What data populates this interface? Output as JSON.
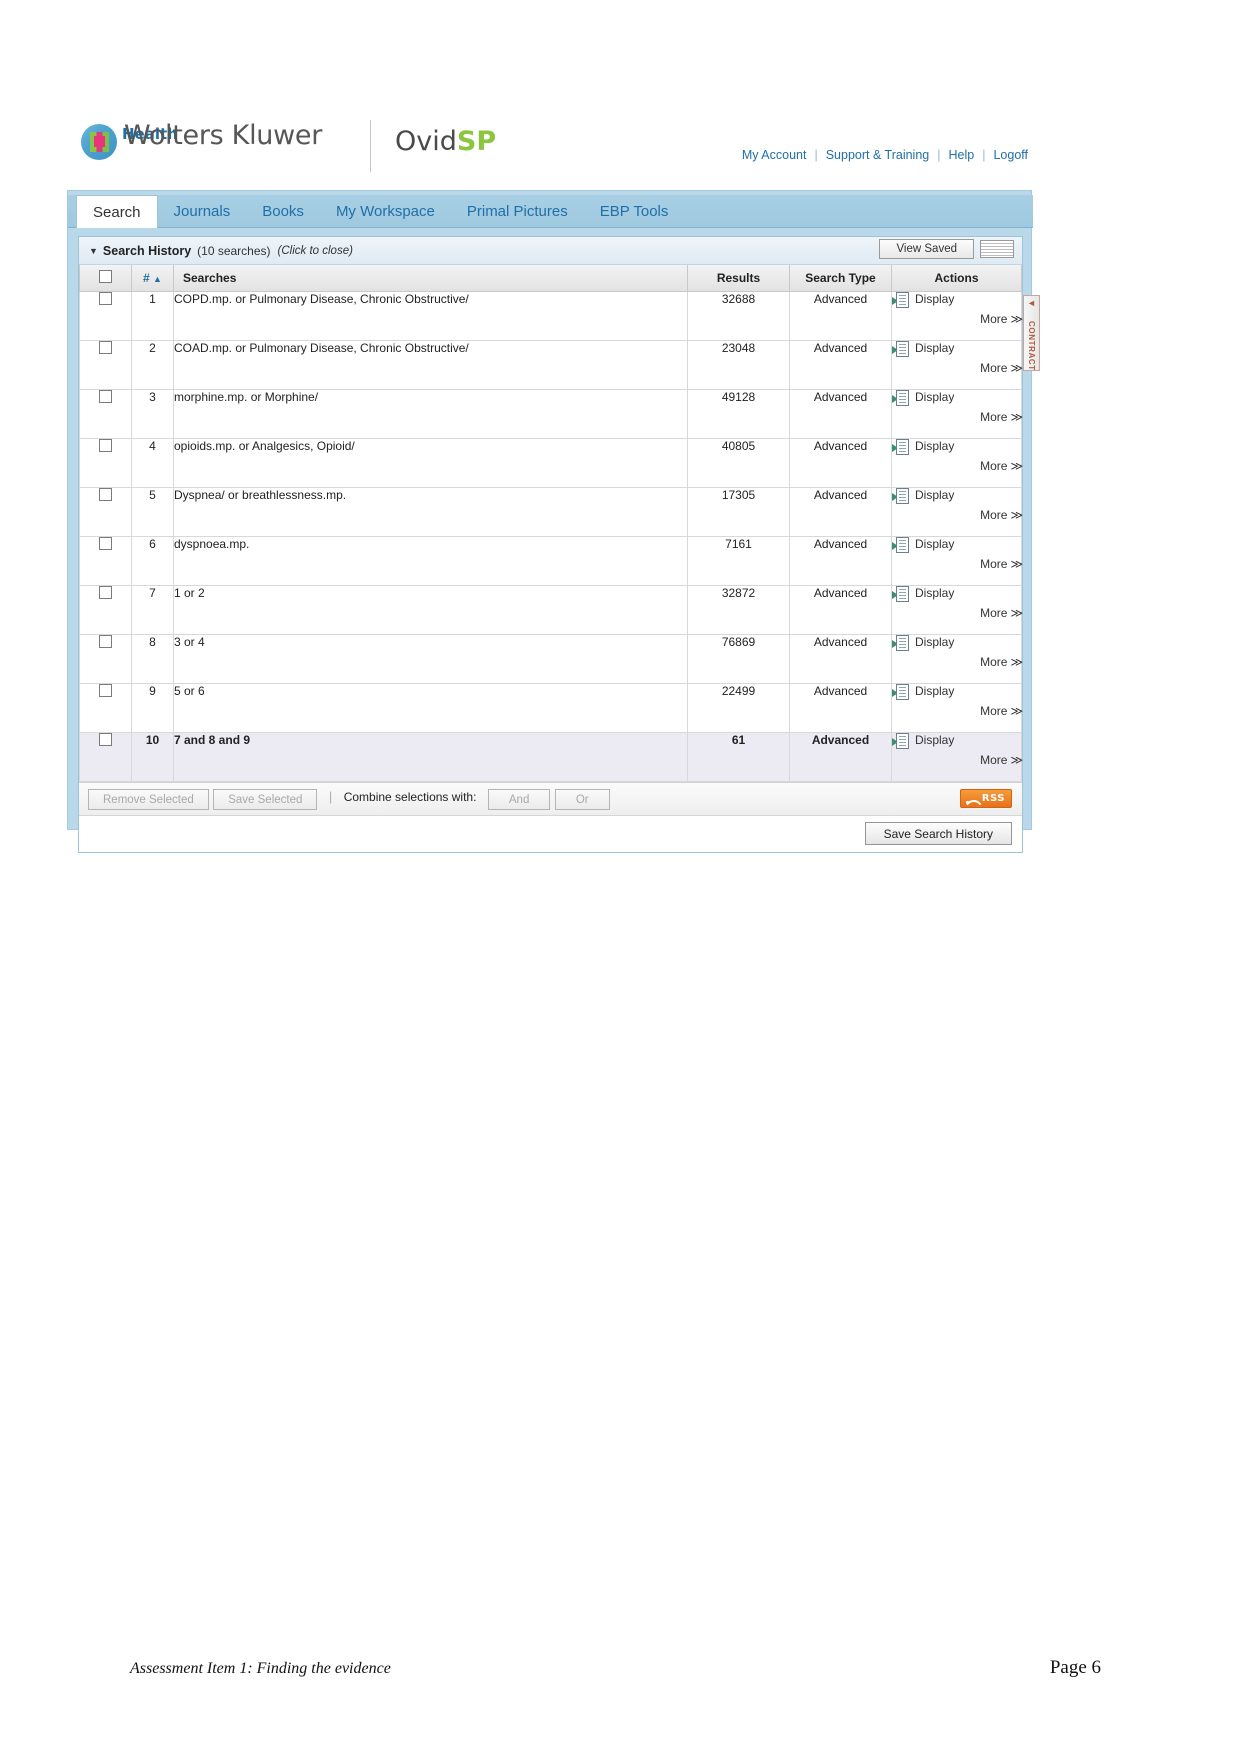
{
  "brand": {
    "company": "Wolters Kluwer",
    "division": "Health",
    "product_prefix": "Ovid",
    "product_suffix": "SP",
    "globe_icon": "wolters-kluwer-globe-icon"
  },
  "top_links": [
    {
      "label": "My Account"
    },
    {
      "label": "Support & Training"
    },
    {
      "label": "Help"
    },
    {
      "label": "Logoff"
    }
  ],
  "tabs": [
    {
      "label": "Search",
      "active": true
    },
    {
      "label": "Journals",
      "active": false
    },
    {
      "label": "Books",
      "active": false
    },
    {
      "label": "My Workspace",
      "active": false
    },
    {
      "label": "Primal Pictures",
      "active": false
    },
    {
      "label": "EBP Tools",
      "active": false
    }
  ],
  "history_panel": {
    "caret": "▼",
    "title": "Search History",
    "count": "(10 searches)",
    "click_hint": "(Click to close)",
    "view_saved_label": "View Saved",
    "stripe_icon": "list-view-icon",
    "contract_label": "CONTRACT",
    "contract_arrow": "◄"
  },
  "table": {
    "headers": {
      "select_all": "select-all-checkbox",
      "number": "#",
      "sort_arrow": "▲",
      "searches": "Searches",
      "results": "Results",
      "search_type": "Search Type",
      "actions": "Actions"
    },
    "action_labels": {
      "display": "Display",
      "more": "More",
      "more_chevron": "≫"
    },
    "rows": [
      {
        "num": "1",
        "query": "COPD.mp. or Pulmonary Disease, Chronic Obstructive/",
        "results": "32688",
        "type": "Advanced",
        "highlight": false
      },
      {
        "num": "2",
        "query": "COAD.mp. or Pulmonary Disease, Chronic Obstructive/",
        "results": "23048",
        "type": "Advanced",
        "highlight": false
      },
      {
        "num": "3",
        "query": "morphine.mp. or Morphine/",
        "results": "49128",
        "type": "Advanced",
        "highlight": false
      },
      {
        "num": "4",
        "query": "opioids.mp. or Analgesics, Opioid/",
        "results": "40805",
        "type": "Advanced",
        "highlight": false
      },
      {
        "num": "5",
        "query": "Dyspnea/ or breathlessness.mp.",
        "results": "17305",
        "type": "Advanced",
        "highlight": false
      },
      {
        "num": "6",
        "query": "dyspnoea.mp.",
        "results": "7161",
        "type": "Advanced",
        "highlight": false
      },
      {
        "num": "7",
        "query": "1 or 2",
        "results": "32872",
        "type": "Advanced",
        "highlight": false
      },
      {
        "num": "8",
        "query": "3 or 4",
        "results": "76869",
        "type": "Advanced",
        "highlight": false
      },
      {
        "num": "9",
        "query": "5 or 6",
        "results": "22499",
        "type": "Advanced",
        "highlight": false
      },
      {
        "num": "10",
        "query": "7 and 8 and 9",
        "results": "61",
        "type": "Advanced",
        "highlight": true
      }
    ]
  },
  "toolbar": {
    "remove_selected": "Remove Selected",
    "save_selected": "Save Selected",
    "combine_label": "Combine selections with:",
    "and_label": "And",
    "or_label": "Or",
    "rss_label": "RSS",
    "save_search_history": "Save Search History"
  },
  "footer": {
    "left": "Assessment Item 1: Finding the evidence",
    "right": "Page 6"
  },
  "colors": {
    "panel_blue": "#b9d9ea",
    "link_blue": "#1f6fa8",
    "accent_green": "#8cc63f",
    "highlight_row": "#eceaf3",
    "rss_orange": "#e8701a"
  }
}
